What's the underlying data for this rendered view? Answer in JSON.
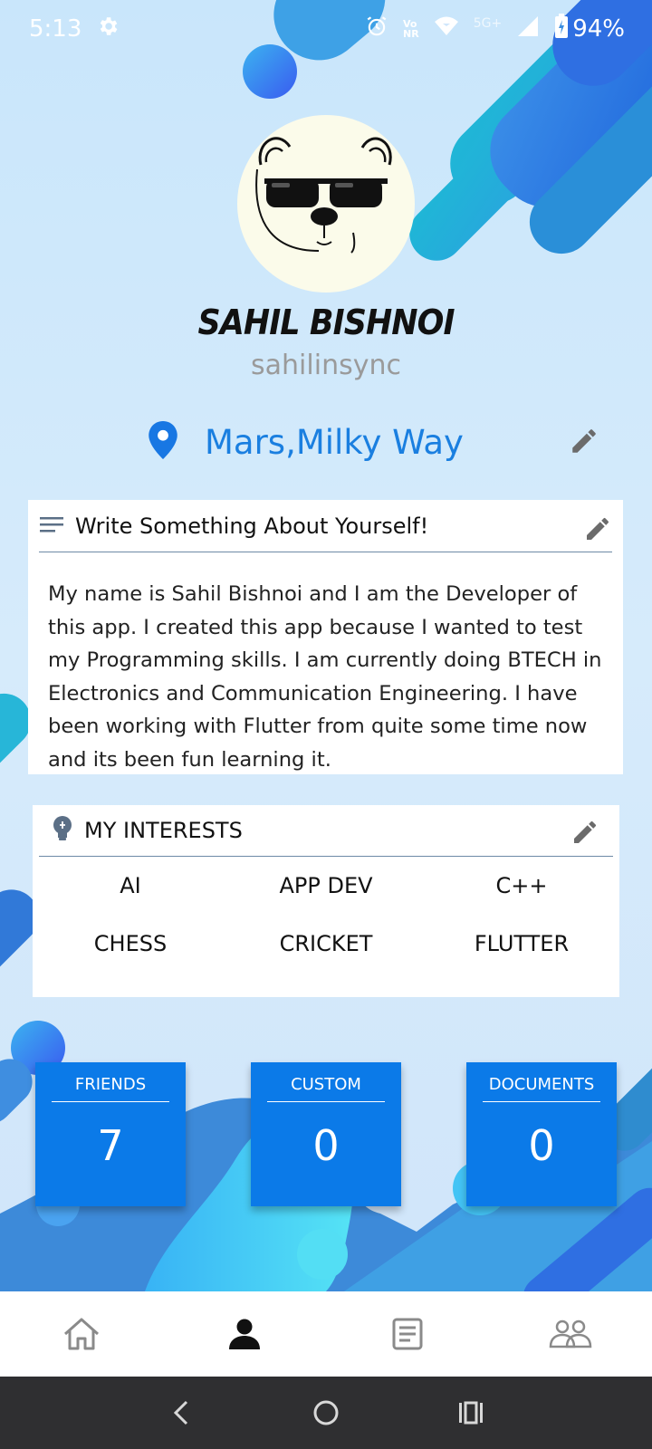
{
  "status_bar": {
    "time": "5:13",
    "network_label_top": "Vo",
    "network_label_bottom": "NR",
    "signal_type": "5G+",
    "battery": "94%",
    "icons": [
      "settings-icon",
      "alarm-icon",
      "volte-icon",
      "wifi-icon",
      "signal-icon",
      "battery-icon"
    ]
  },
  "profile": {
    "name": "SAHIL BISHNOI",
    "username": "sahilinsync",
    "location": "Mars,Milky Way",
    "avatar_icon": "polar-bear-sunglasses-avatar"
  },
  "about": {
    "title": "Write Something About Yourself!",
    "text": "My name is Sahil Bishnoi and I am the Developer of this app. I created this app because I wanted to test my Programming skills. I am currently doing BTECH in Electronics and Communication Engineering. I have been working with Flutter from quite some time now and its been fun learning it."
  },
  "interests": {
    "title": "MY INTERESTS",
    "items": [
      "AI",
      "APP DEV",
      "C++",
      "CHESS",
      "CRICKET",
      "FLUTTER"
    ]
  },
  "stats": [
    {
      "label": "FRIENDS",
      "value": "7"
    },
    {
      "label": "CUSTOM",
      "value": "0"
    },
    {
      "label": "DOCUMENTS",
      "value": "0"
    }
  ],
  "bottom_nav": {
    "items": [
      "home-icon",
      "profile-icon",
      "documents-icon",
      "groups-icon"
    ],
    "active": "profile-icon"
  },
  "colors": {
    "accent": "#0b7ae8",
    "location_text": "#1a7fe0",
    "pin": "#1877e3"
  }
}
